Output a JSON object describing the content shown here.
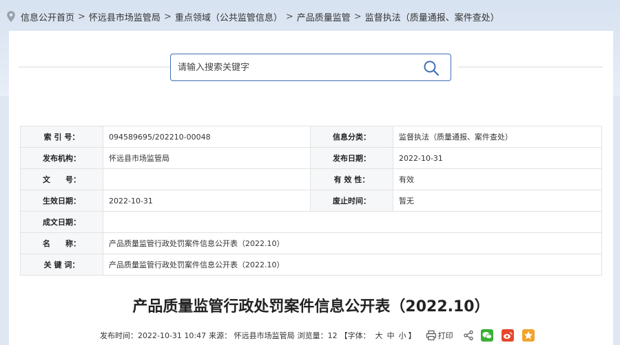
{
  "breadcrumb": {
    "items": [
      "信息公开首页",
      "怀远县市场监管局",
      "重点领域（公共监管信息）",
      "产品质量监管",
      "监督执法（质量通报、案件查处）"
    ],
    "separator": ">"
  },
  "search": {
    "placeholder": "请输入搜索关键字"
  },
  "meta": {
    "index_label": "索 引 号：",
    "index_value": "094589695/202210-00048",
    "category_label": "信息分类：",
    "category_value": "监督执法（质量通报、案件查处）",
    "publisher_label": "发布机构：",
    "publisher_value": "怀远县市场监管局",
    "pubdate_label": "发布日期：",
    "pubdate_value": "2022-10-31",
    "docno_label": "文　　号：",
    "docno_value": "",
    "validity_label": "有 效 性：",
    "validity_value": "有效",
    "effective_label": "生效日期：",
    "effective_value": "2022-10-31",
    "abolish_label": "废止时间：",
    "abolish_value": "暂无",
    "created_label": "成文日期：",
    "created_value": "",
    "name_label": "名　　称：",
    "name_value": "产品质量监管行政处罚案件信息公开表（2022.10）",
    "keywords_label": "关 键 词：",
    "keywords_value": "产品质量监管行政处罚案件信息公开表（2022.10）"
  },
  "article": {
    "title": "产品质量监管行政处罚案件信息公开表（2022.10）",
    "publish_time": "发布时间：2022-10-31 10:47",
    "source": "来源： 怀远县市场监管局",
    "views": "浏览量：12",
    "font_size_prefix": "【字体：",
    "font_large": "大",
    "font_medium": "中",
    "font_small": "小",
    "font_size_suffix": "】",
    "print_label": "打印"
  },
  "colors": {
    "accent": "#3c6fb3",
    "wechat": "#3cb034",
    "weibo": "#e6472b",
    "favorite": "#f3a32b"
  }
}
